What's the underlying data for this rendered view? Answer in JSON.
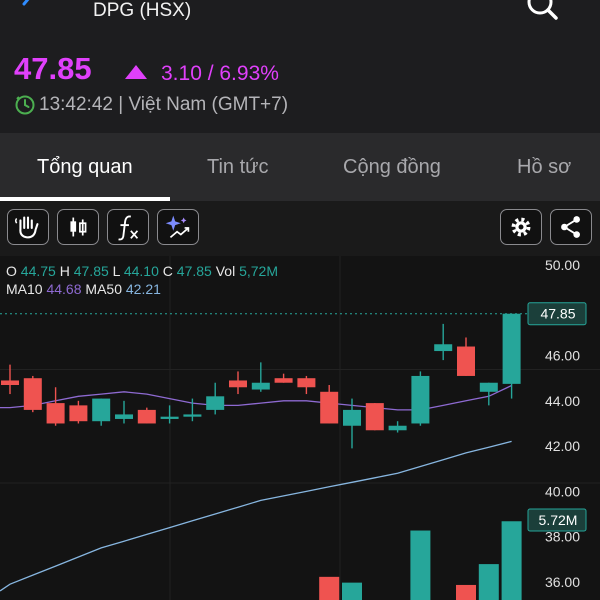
{
  "header": {
    "ticker": "DPG (HSX)",
    "price": "47.85",
    "change": "3.10 / 6.93%",
    "time": "13:42:42 | Việt Nam (GMT+7)"
  },
  "tabs": [
    {
      "label": "Tổng quan",
      "active": true
    },
    {
      "label": "Tin tức",
      "active": false
    },
    {
      "label": "Cộng đồng",
      "active": false
    },
    {
      "label": "Hồ sơ",
      "active": false
    }
  ],
  "toolbar": {
    "buttons": [
      "hand-icon",
      "candlestick-icon",
      "function-icon",
      "ai-sparkle-icon"
    ],
    "right_buttons": [
      "gear-icon",
      "share-icon"
    ]
  },
  "legend": {
    "o_label": "O",
    "o": "44.75",
    "h_label": "H",
    "h": "47.85",
    "l_label": "L",
    "l": "44.10",
    "c_label": "C",
    "c": "47.85",
    "vol_label": "Vol",
    "vol": "5,72M",
    "ma10_label": "MA10",
    "ma10": "44.68",
    "ma50_label": "MA50",
    "ma50": "42.21"
  },
  "colors": {
    "up": "#26a69a",
    "down": "#ef5350",
    "price": "#e040fb",
    "ma10": "#8e6ad2",
    "ma50": "#87b6e0"
  },
  "chart_data": {
    "type": "candlestick",
    "y_ticks": [
      "50.00",
      "46.00",
      "44.00",
      "42.00",
      "40.00",
      "38.00",
      "36.00"
    ],
    "ylim": [
      35.2,
      50.4
    ],
    "last_price_label": "47.85",
    "last_volume_label": "5.72M",
    "candles": [
      {
        "o": 44.9,
        "h": 45.6,
        "l": 44.3,
        "c": 44.7
      },
      {
        "o": 45.0,
        "h": 45.1,
        "l": 43.5,
        "c": 43.6
      },
      {
        "o": 43.9,
        "h": 44.6,
        "l": 42.9,
        "c": 43.0
      },
      {
        "o": 43.8,
        "h": 44.0,
        "l": 43.0,
        "c": 43.1
      },
      {
        "o": 43.1,
        "h": 44.1,
        "l": 42.9,
        "c": 44.1
      },
      {
        "o": 43.2,
        "h": 44.0,
        "l": 43.0,
        "c": 43.4
      },
      {
        "o": 43.6,
        "h": 43.7,
        "l": 43.0,
        "c": 43.0
      },
      {
        "o": 43.2,
        "h": 43.8,
        "l": 43.0,
        "c": 43.3
      },
      {
        "o": 43.3,
        "h": 44.1,
        "l": 43.1,
        "c": 43.4
      },
      {
        "o": 43.6,
        "h": 44.8,
        "l": 43.4,
        "c": 44.2
      },
      {
        "o": 44.9,
        "h": 45.3,
        "l": 44.3,
        "c": 44.6
      },
      {
        "o": 44.5,
        "h": 45.7,
        "l": 44.4,
        "c": 44.8
      },
      {
        "o": 45.0,
        "h": 45.2,
        "l": 44.8,
        "c": 44.8
      },
      {
        "o": 45.0,
        "h": 45.1,
        "l": 44.3,
        "c": 44.6
      },
      {
        "o": 44.4,
        "h": 44.7,
        "l": 43.0,
        "c": 43.0
      },
      {
        "o": 42.9,
        "h": 44.1,
        "l": 41.9,
        "c": 43.6
      },
      {
        "o": 43.9,
        "h": 43.9,
        "l": 42.7,
        "c": 42.7
      },
      {
        "o": 42.7,
        "h": 43.1,
        "l": 42.6,
        "c": 42.9
      },
      {
        "o": 43.0,
        "h": 45.3,
        "l": 42.9,
        "c": 45.1
      },
      {
        "o": 46.2,
        "h": 47.4,
        "l": 45.8,
        "c": 46.5
      },
      {
        "o": 46.4,
        "h": 46.8,
        "l": 45.1,
        "c": 45.1
      },
      {
        "o": 44.4,
        "h": 44.8,
        "l": 43.8,
        "c": 44.8
      },
      {
        "o": 44.75,
        "h": 47.85,
        "l": 44.1,
        "c": 47.85
      }
    ],
    "volume": [
      0,
      0,
      0,
      0,
      0,
      0,
      0,
      0,
      0,
      0,
      0,
      0,
      0,
      0,
      1.0,
      0.75,
      0,
      0,
      3.0,
      0,
      0.65,
      1.55,
      3.4
    ],
    "ma10": [
      43.7,
      43.8,
      44.0,
      44.2,
      44.3,
      44.4,
      44.3,
      44.1,
      43.9,
      43.8,
      43.8,
      43.9,
      44.0,
      44.0,
      43.9,
      43.8,
      43.7,
      43.6,
      43.6,
      43.8,
      44.0,
      44.2,
      44.68
    ],
    "ma50": [
      35.9,
      36.3,
      36.7,
      37.1,
      37.5,
      37.8,
      38.1,
      38.4,
      38.7,
      39.0,
      39.3,
      39.6,
      39.8,
      40.0,
      40.2,
      40.4,
      40.6,
      40.8,
      41.1,
      41.4,
      41.7,
      41.95,
      42.21
    ]
  }
}
